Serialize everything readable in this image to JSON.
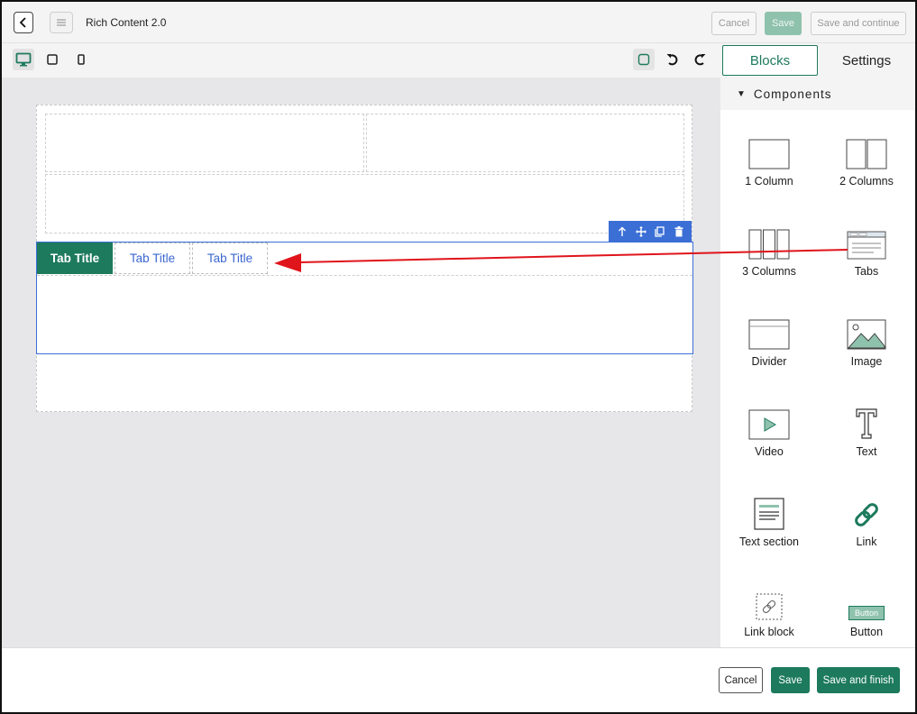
{
  "header": {
    "title": "Rich Content 2.0",
    "cancel_label": "Cancel",
    "save_label": "Save",
    "save_continue_label": "Save and continue"
  },
  "canvas": {
    "tabs": [
      {
        "label": "Tab Title",
        "active": true
      },
      {
        "label": "Tab Title",
        "active": false
      },
      {
        "label": "Tab Title",
        "active": false
      }
    ]
  },
  "panel": {
    "tabs": [
      {
        "label": "Blocks",
        "active": true
      },
      {
        "label": "Settings",
        "active": false
      }
    ],
    "section_label": "Components",
    "components": [
      {
        "label": "1 Column",
        "icon": "one-column-icon"
      },
      {
        "label": "2 Columns",
        "icon": "two-columns-icon"
      },
      {
        "label": "3 Columns",
        "icon": "three-columns-icon"
      },
      {
        "label": "Tabs",
        "icon": "tabs-icon"
      },
      {
        "label": "Divider",
        "icon": "divider-icon"
      },
      {
        "label": "Image",
        "icon": "image-icon"
      },
      {
        "label": "Video",
        "icon": "video-icon"
      },
      {
        "label": "Text",
        "icon": "text-icon"
      },
      {
        "label": "Text section",
        "icon": "text-section-icon"
      },
      {
        "label": "Link",
        "icon": "link-icon"
      },
      {
        "label": "Link block",
        "icon": "link-block-icon"
      },
      {
        "label": "Button",
        "icon": "button-icon",
        "icon_text": "Button"
      }
    ]
  },
  "footer": {
    "cancel_label": "Cancel",
    "save_label": "Save",
    "save_finish_label": "Save and finish"
  },
  "colors": {
    "primary": "#1d7a5d",
    "selection": "#3b6fd6",
    "arrow": "#e0141b"
  }
}
